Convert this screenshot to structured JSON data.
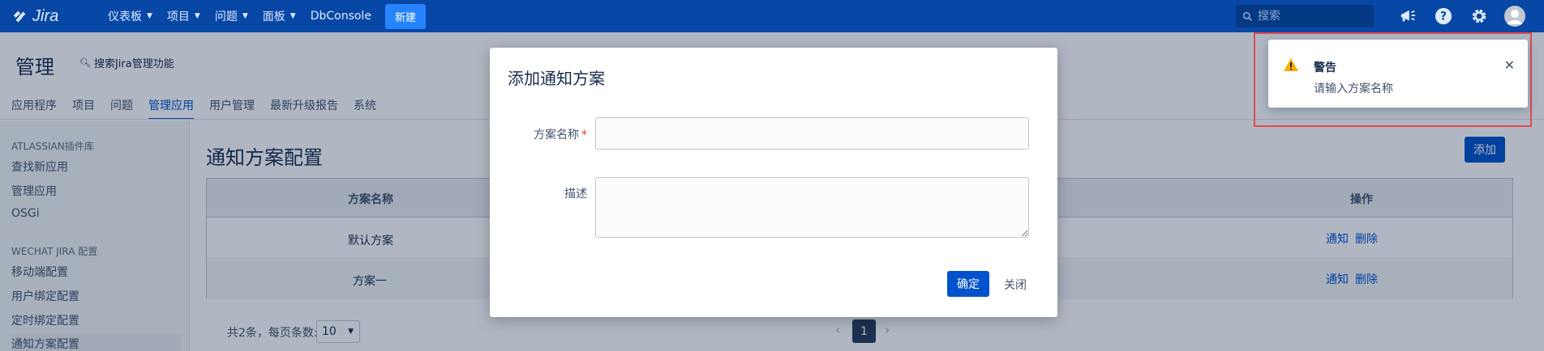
{
  "topnav": {
    "logo_text": "Jira",
    "menu": [
      {
        "label": "仪表板",
        "chevron": true
      },
      {
        "label": "项目",
        "chevron": true
      },
      {
        "label": "问题",
        "chevron": true
      },
      {
        "label": "面板",
        "chevron": true
      },
      {
        "label": "DbConsole",
        "chevron": false
      }
    ],
    "create_label": "新建",
    "search_placeholder": "搜索",
    "icons": [
      "megaphone-icon",
      "help-icon",
      "gear-icon",
      "avatar-icon"
    ]
  },
  "admin": {
    "title": "管理",
    "search_label": "搜索Jira管理功能",
    "tabs": [
      "应用程序",
      "项目",
      "问题",
      "管理应用",
      "用户管理",
      "最新升级报告",
      "系统"
    ],
    "active_tab": "管理应用"
  },
  "sidebar": {
    "sections": [
      {
        "heading": "ATLASSIAN插件库",
        "items": [
          "查找新应用",
          "管理应用",
          "OSGi"
        ]
      },
      {
        "heading": "WECHAT JIRA 配置",
        "items": [
          "移动端配置",
          "用户绑定配置",
          "定时绑定配置",
          "通知方案配置"
        ]
      }
    ],
    "active_item": "通知方案配置"
  },
  "main": {
    "title": "通知方案配置",
    "add_label": "添加",
    "table": {
      "columns": [
        "方案名称",
        "操作"
      ],
      "rows": [
        {
          "name": "默认方案",
          "actions": [
            "通知",
            "删除"
          ]
        },
        {
          "name": "方案一",
          "actions": [
            "通知",
            "删除"
          ]
        }
      ]
    },
    "pagination": {
      "summary": "共2条，每页条数:",
      "page_size": "10",
      "current_page": "1"
    }
  },
  "dialog": {
    "title": "添加通知方案",
    "name_label": "方案名称",
    "required_mark": "*",
    "description_label": "描述",
    "name_value": "",
    "description_value": "",
    "ok_label": "确定",
    "close_label": "关闭"
  },
  "flag": {
    "title": "警告",
    "message": "请输入方案名称",
    "icon": "warning-icon",
    "highlight_color": "#e5484d"
  },
  "colors": {
    "nav_bg": "#0747a6",
    "primary": "#0052cc",
    "warning": "#ffab00"
  }
}
